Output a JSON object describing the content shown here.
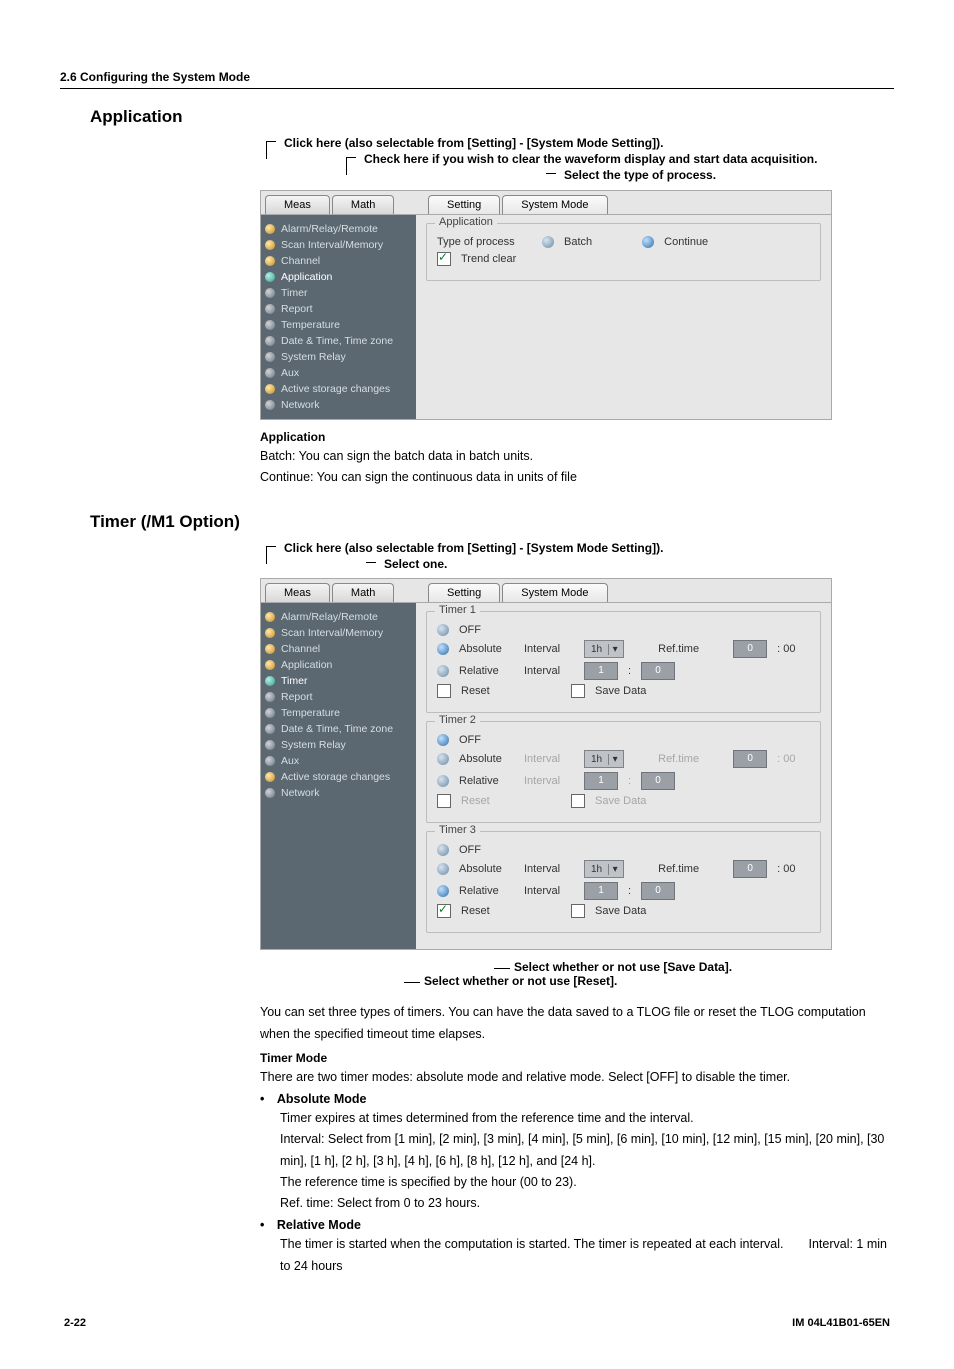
{
  "section_header": "2.6  Configuring the System Mode",
  "app": {
    "heading": "Application",
    "caption1": "Click here (also selectable from [Setting] - [System Mode Setting]).",
    "caption2": "Check here if you wish to clear the waveform display and start data acquisition.",
    "caption3": "Select the type of process.",
    "tabs_left": [
      "Meas",
      "Math"
    ],
    "tabs_right": [
      "Setting",
      "System Mode"
    ],
    "side_items": [
      "Alarm/Relay/Remote",
      "Scan Interval/Memory",
      "Channel",
      "Application",
      "Timer",
      "Report",
      "Temperature",
      "Date & Time, Time zone",
      "System Relay",
      "Aux",
      "Active storage changes",
      "Network"
    ],
    "group_title": "Application",
    "row1_label": "Type of process",
    "row1_opt1": "Batch",
    "row1_opt2": "Continue",
    "row2_label": "Trend clear",
    "subhead": "Application",
    "desc1": "Batch: You can sign the batch data in batch units.",
    "desc2": "Continue:  You can sign the continuous data in units of file"
  },
  "timer": {
    "heading": "Timer (/M1 Option)",
    "caption1": "Click here (also selectable from [Setting] - [System Mode Setting]).",
    "caption2": "Select one.",
    "groups": [
      {
        "title": "Timer 1",
        "off": "OFF",
        "abs": "Absolute",
        "rel": "Relative",
        "interval_lbl": "Interval",
        "interval_val": "1h",
        "reftime_lbl": "Ref.time",
        "reftime_val": "0",
        "reftime_min": ": 00",
        "rel_interval_lbl": "Interval",
        "rel_h": "1",
        "rel_m": "0",
        "reset": "Reset",
        "save": "Save Data",
        "abs_selected": true,
        "reset_checked": false,
        "save_checked": false,
        "disabled": false
      },
      {
        "title": "Timer 2",
        "off": "OFF",
        "abs": "Absolute",
        "rel": "Relative",
        "interval_lbl": "Interval",
        "interval_val": "1h",
        "reftime_lbl": "Ref.time",
        "reftime_val": "0",
        "reftime_min": ": 00",
        "rel_interval_lbl": "Interval",
        "rel_h": "1",
        "rel_m": "0",
        "reset": "Reset",
        "save": "Save Data",
        "off_selected": true,
        "reset_checked": false,
        "save_checked": false,
        "disabled": true
      },
      {
        "title": "Timer 3",
        "off": "OFF",
        "abs": "Absolute",
        "rel": "Relative",
        "interval_lbl": "Interval",
        "interval_val": "1h",
        "reftime_lbl": "Ref.time",
        "reftime_val": "0",
        "reftime_min": ": 00",
        "rel_interval_lbl": "Interval",
        "rel_h": "1",
        "rel_m": "0",
        "reset": "Reset",
        "save": "Save Data",
        "rel_selected": true,
        "reset_checked": true,
        "save_checked": false,
        "disabled": false
      }
    ],
    "note_save": "Select whether or not use [Save Data].",
    "note_reset": "Select whether or not use [Reset].",
    "para1": "You can set three types of timers. You can have the data saved to a TLOG file or reset the TLOG computation when the specified timeout time elapses.",
    "mode_head": "Timer Mode",
    "mode_para": "There are two timer modes: absolute mode and relative mode. Select [OFF] to disable the timer.",
    "abs_head": "• Absolute Mode",
    "abs_p1": "Timer expires at times determined from the reference time and the interval.",
    "abs_p2": "Interval: Select from [1 min], [2 min], [3 min], [4 min], [5 min], [6 min], [10 min], [12 min], [15 min], [20 min], [30 min], [1 h], [2 h], [3 h], [4 h], [6 h], [8 h], [12 h], and [24 h].",
    "abs_p3": "The reference time is specified by the hour (00 to 23).",
    "abs_p4": "Ref. time: Select from 0 to 23 hours.",
    "rel_head": "• Relative Mode",
    "rel_p1": "The timer is started when the computation is started. The timer is repeated at each interval.  Interval: 1 min to 24 hours"
  },
  "footer": {
    "page": "2-22",
    "doc": "IM 04L41B01-65EN"
  }
}
